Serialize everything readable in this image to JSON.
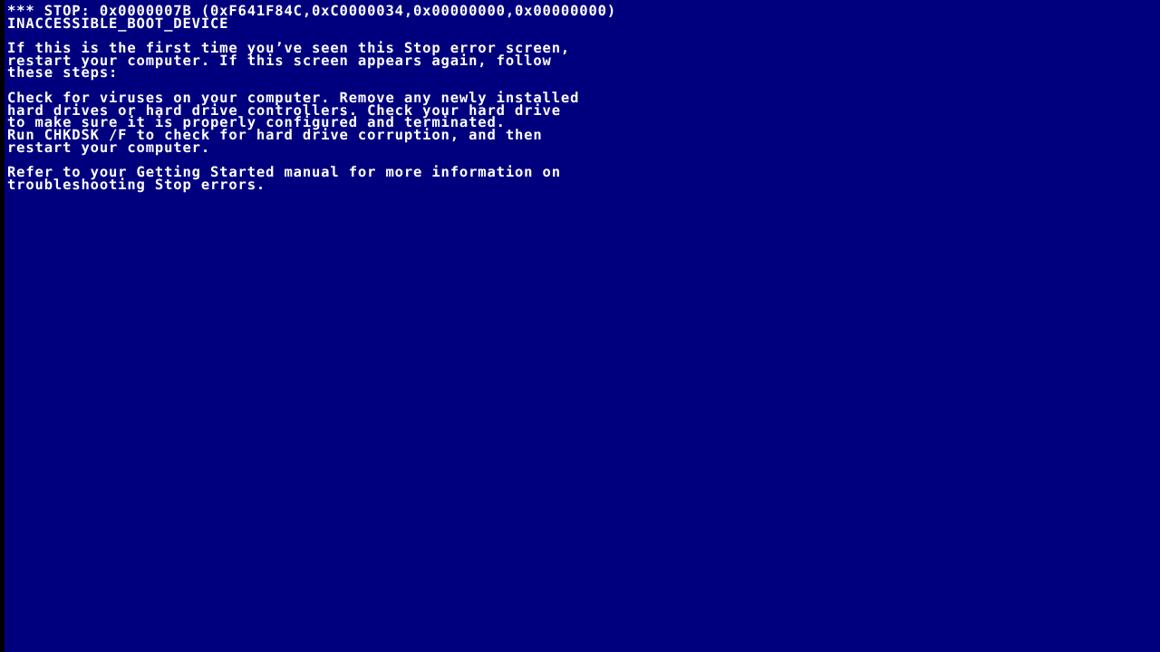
{
  "screen": {
    "kind": "windows-stop-error-screen",
    "background_color": "#00007F",
    "text_color": "#FFFFFF",
    "edge_bar_color": "#000000"
  },
  "stop_header": {
    "line1": "*** STOP: 0x0000007B (0xF641F84C,0xC0000034,0x00000000,0x00000000)",
    "line2": "INACCESSIBLE_BOOT_DEVICE",
    "stop_code": "0x0000007B",
    "bugcheck_name": "INACCESSIBLE_BOOT_DEVICE",
    "parameters": [
      "0xF641F84C",
      "0xC0000034",
      "0x00000000",
      "0x00000000"
    ]
  },
  "paragraphs": [
    {
      "name": "first-time-advice",
      "lines": [
        "If this is the first time you’ve seen this Stop error screen,",
        "restart your computer. If this screen appears again, follow",
        "these steps:"
      ]
    },
    {
      "name": "troubleshooting-steps",
      "lines": [
        "Check for viruses on your computer. Remove any newly installed",
        "hard drives or hard drive controllers. Check your hard drive",
        "to make sure it is properly configured and terminated.",
        "Run CHKDSK /F to check for hard drive corruption, and then",
        "restart your computer."
      ]
    },
    {
      "name": "manual-reference",
      "lines": [
        "Refer to your Getting Started manual for more information on",
        "troubleshooting Stop errors."
      ]
    }
  ]
}
